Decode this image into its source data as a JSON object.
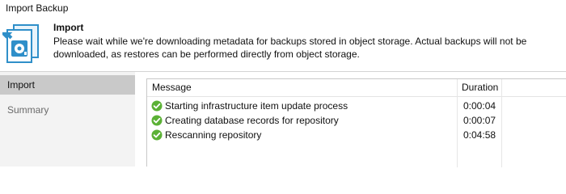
{
  "window": {
    "title": "Import Backup"
  },
  "header": {
    "title": "Import",
    "description": "Please wait while we're downloading metadata for backups stored in object storage. Actual backups will not be downloaded, as restores can be performed directly from object storage.",
    "icon": "import-backup-icon"
  },
  "sidebar": {
    "items": [
      {
        "label": "Import",
        "active": true
      },
      {
        "label": "Summary",
        "active": false
      }
    ]
  },
  "log": {
    "columns": {
      "message": "Message",
      "duration": "Duration"
    },
    "rows": [
      {
        "status": "success",
        "message": "Starting infrastructure item update process",
        "duration": "0:00:04"
      },
      {
        "status": "success",
        "message": "Creating database records for repository",
        "duration": "0:00:07"
      },
      {
        "status": "success",
        "message": "Rescanning repository",
        "duration": "0:04:58"
      }
    ]
  },
  "colors": {
    "success": "#5bb135",
    "sidebar_active": "#c9c9c9",
    "sidebar_bg": "#f3f3f3"
  }
}
